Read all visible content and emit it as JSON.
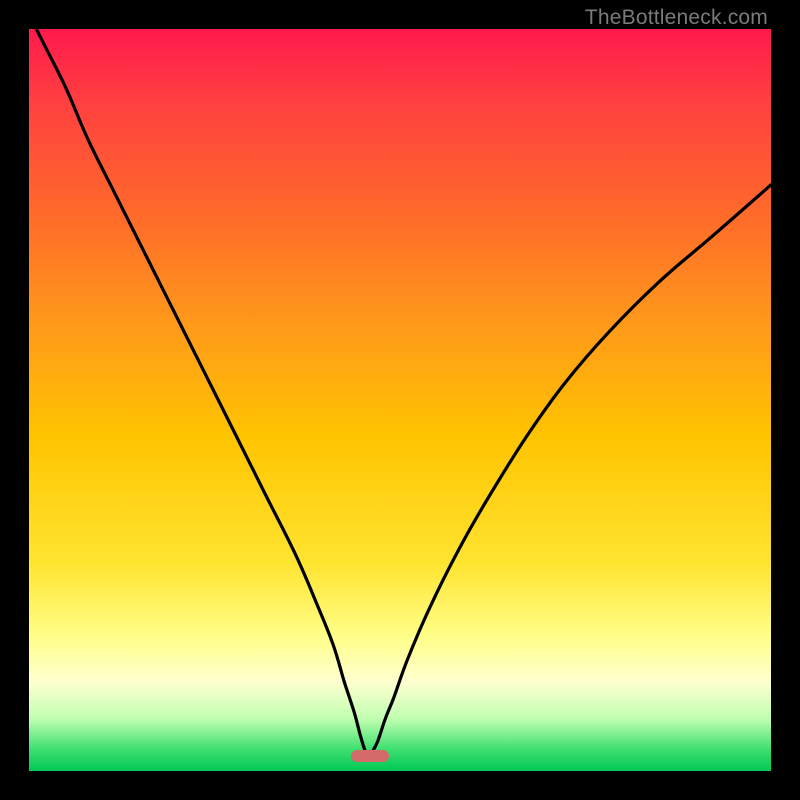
{
  "watermark": {
    "text": "TheBottleneck.com"
  },
  "colors": {
    "curve": "#000000",
    "marker": "#d46a6a",
    "frame_bg": "#000000"
  },
  "chart_data": {
    "type": "line",
    "title": "",
    "xlabel": "",
    "ylabel": "",
    "xlim": [
      0,
      100
    ],
    "ylim": [
      0,
      100
    ],
    "series": [
      {
        "name": "bottleneck-curve",
        "x": [
          0,
          2,
          5,
          8,
          12,
          16,
          20,
          24,
          28,
          32,
          36,
          39,
          41,
          42.5,
          43.8,
          44.6,
          45.2,
          45.7,
          46.2,
          47,
          48,
          49.2,
          51,
          54,
          58,
          62,
          67,
          72,
          78,
          85,
          92,
          100
        ],
        "y": [
          102,
          98,
          92,
          85,
          77,
          69,
          61,
          53,
          45,
          37,
          29,
          22,
          17,
          12,
          8,
          5,
          3,
          2,
          2.5,
          4,
          7,
          10,
          15,
          22,
          30,
          37,
          45,
          52,
          59,
          66,
          72,
          79
        ]
      }
    ],
    "marker": {
      "x_percent": 46,
      "y_percent": 2
    }
  }
}
